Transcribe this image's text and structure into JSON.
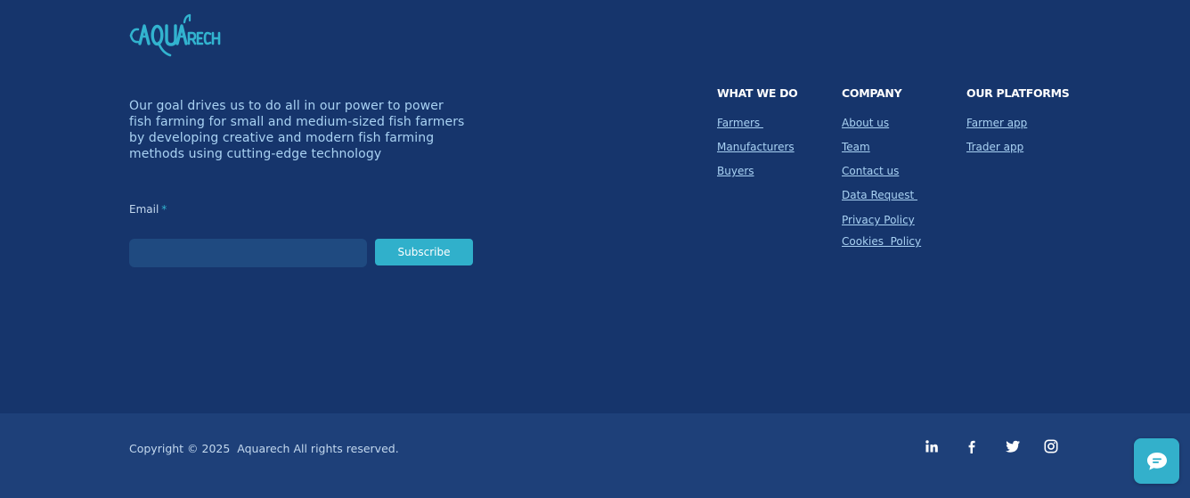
{
  "brand": {
    "logo_text": "AQUARECH",
    "accent_color": "#32b3cf",
    "background_color": "#16356c",
    "bottom_bar_color": "#1e4079"
  },
  "mission_text": "Our goal drives us to do all in our power to power fish farming for small and medium-sized fish farmers by developing creative and modern fish farming methods using cutting-edge technology",
  "newsletter": {
    "email_label": "Email",
    "required_marker": "*",
    "email_value": "",
    "subscribe_label": "Subscribe"
  },
  "columns": {
    "what_we_do": {
      "heading": "WHAT WE DO",
      "links": [
        "Farmers ",
        "Manufacturers",
        "Buyers"
      ]
    },
    "company": {
      "heading": "COMPANY",
      "links": [
        "About us",
        "Team",
        "Contact us",
        "Data Request ",
        "Privacy Policy",
        "Cookies  Policy"
      ]
    },
    "platforms": {
      "heading": "OUR PLATFORMS",
      "links": [
        "Farmer app",
        "Trader app"
      ]
    }
  },
  "bottom": {
    "copyright": "Copyright © 2025  Aquarech All rights reserved."
  },
  "social_icons": [
    "linkedin-icon",
    "facebook-icon",
    "twitter-icon",
    "instagram-icon"
  ],
  "chat": {
    "icon": "chat-bubble-icon"
  }
}
